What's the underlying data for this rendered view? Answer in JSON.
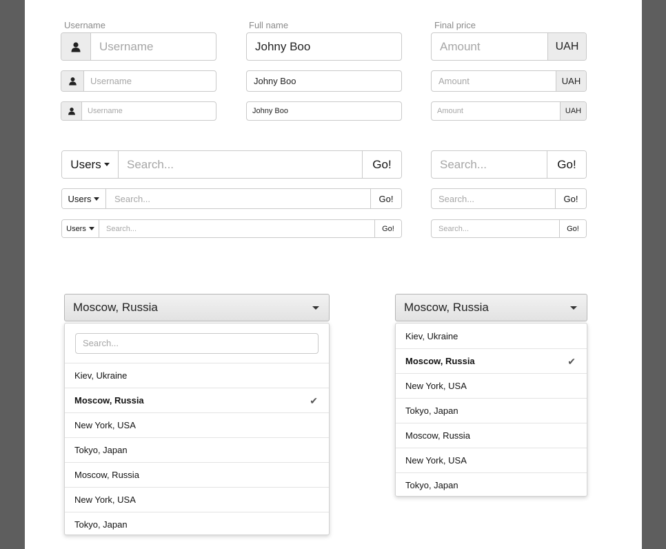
{
  "labels": {
    "username": "Username",
    "fullname": "Full name",
    "price": "Final price"
  },
  "username_field": {
    "placeholder": "Username",
    "icon": "user-icon"
  },
  "fullname_field": {
    "value": "Johny Boo"
  },
  "price_field": {
    "placeholder": "Amount",
    "currency": "UAH"
  },
  "search_group": {
    "dropdown_label": "Users",
    "placeholder": "Search...",
    "go_label": "Go!"
  },
  "dropdowns": {
    "selected": "Moscow, Russia",
    "search_placeholder": "Search...",
    "check_icon": "check-icon",
    "options_with_search": [
      "Kiev, Ukraine",
      "Moscow, Russia",
      "New York, USA",
      "Tokyo, Japan",
      "Moscow, Russia",
      "New York, USA",
      "Tokyo, Japan"
    ],
    "options_plain": [
      "Kiev, Ukraine",
      "Moscow, Russia",
      "New York, USA",
      "Tokyo, Japan",
      "Moscow, Russia",
      "New York, USA",
      "Tokyo, Japan"
    ],
    "selected_index": 1
  },
  "colors": {
    "background": "#5e5e5e",
    "page": "#ffffff",
    "addon": "#ececec",
    "border": "#c9c9c9"
  }
}
